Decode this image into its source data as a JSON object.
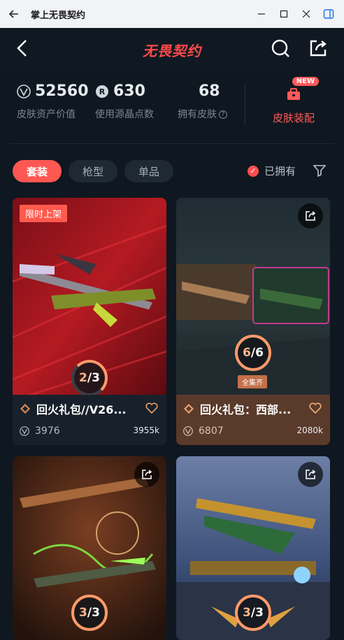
{
  "window": {
    "title": "掌上无畏契约"
  },
  "app": {
    "logo": "无畏契约"
  },
  "stats": [
    {
      "value": "52560",
      "label": "皮肤资产价值",
      "icon": "valorant-points-icon"
    },
    {
      "value": "630",
      "label": "使用源晶点数",
      "icon": "radianite-icon"
    },
    {
      "value": "68",
      "label": "拥有皮肤",
      "icon": ""
    }
  ],
  "equip": {
    "badge": "NEW",
    "label": "皮肤装配"
  },
  "tabs": [
    "套装",
    "枪型",
    "单品"
  ],
  "owned_filter": {
    "label": "已拥有",
    "checked": true
  },
  "cards": [
    {
      "name": "回火礼包//V26...",
      "count": "3976",
      "size": "3955k",
      "progress": "2/3",
      "progress_current": "2",
      "progress_total": "3",
      "promo": "限时上架"
    },
    {
      "name": "回火礼包：西部...",
      "count": "6807",
      "size": "2080k",
      "progress": "6/6",
      "progress_current": "6",
      "progress_total": "6",
      "complete_label": "全集齐"
    },
    {
      "progress": "3/3",
      "progress_current": "3",
      "progress_total": "3"
    },
    {
      "progress": "3/3",
      "progress_current": "3",
      "progress_total": "3"
    }
  ],
  "colors": {
    "accent": "#ff5752",
    "background": "#0f1720",
    "card_info": "#18212b",
    "card_info_owned": "#5a3a2a"
  }
}
